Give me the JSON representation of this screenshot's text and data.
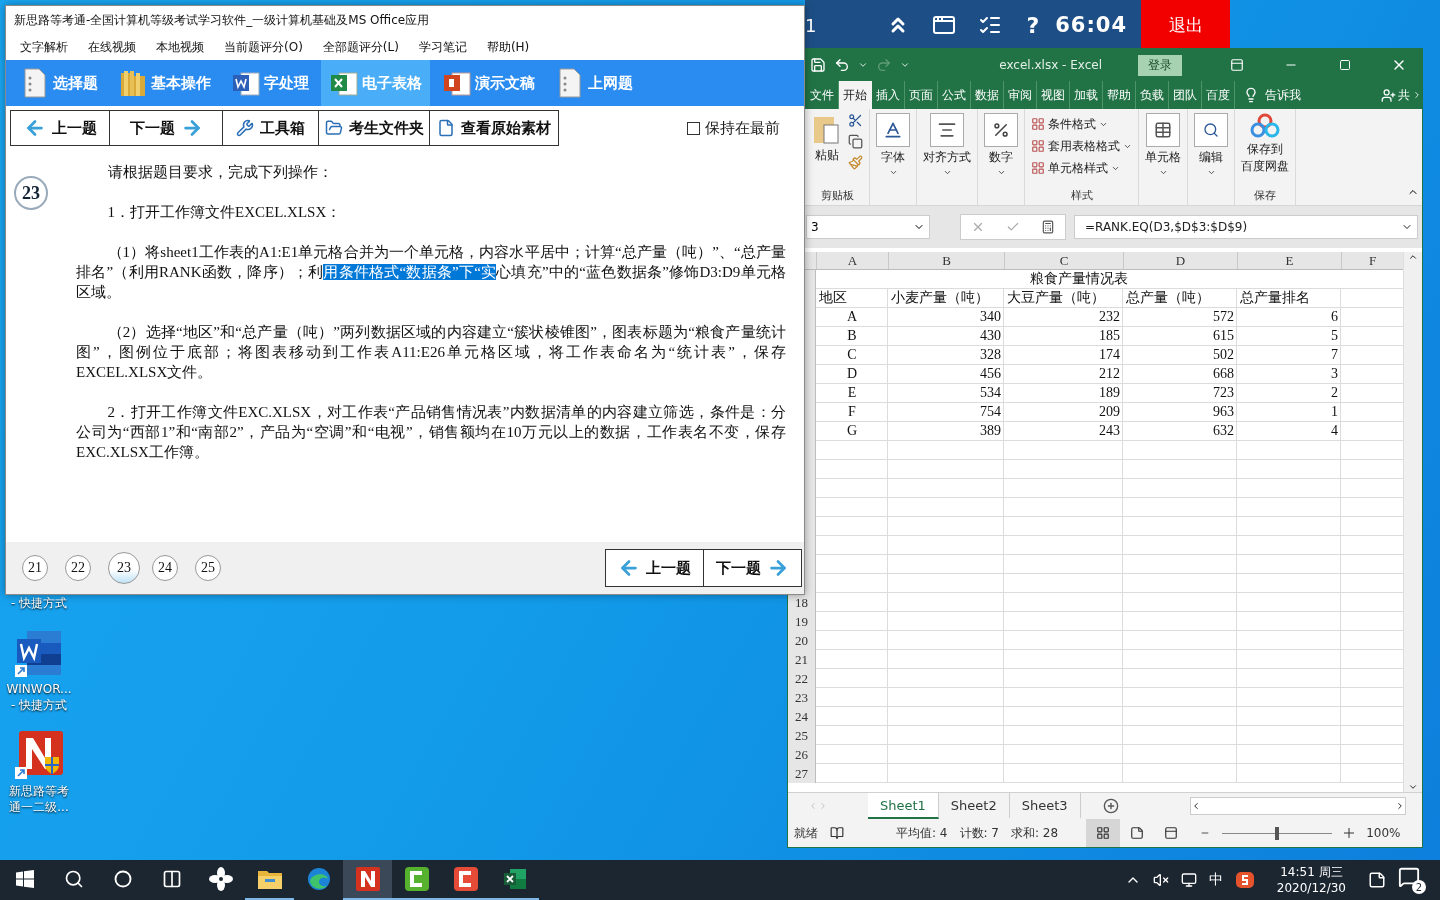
{
  "exam_bar": {
    "cut_text": "1",
    "help_glyph": "?",
    "timer": "66:04",
    "exit_button": "退出"
  },
  "exam_window": {
    "title": "新思路等考通-全国计算机等级考试学习软件_一级计算机基础及MS Office应用",
    "menu": [
      "文字解析",
      "在线视频",
      "本地视频",
      "当前题评分(O)",
      "全部题评分(L)",
      "学习笔记",
      "帮助(H)"
    ],
    "modules": [
      {
        "label": "选择题",
        "kind": "doc",
        "selected": false
      },
      {
        "label": "基本操作",
        "kind": "folder",
        "selected": false
      },
      {
        "label": "字处理",
        "kind": "word",
        "selected": false
      },
      {
        "label": "电子表格",
        "kind": "excel",
        "selected": true
      },
      {
        "label": "演示文稿",
        "kind": "ppt",
        "selected": false
      },
      {
        "label": "上网题",
        "kind": "doc",
        "selected": false
      }
    ],
    "toolbar": [
      {
        "label": "上一题",
        "kind": "prev"
      },
      {
        "label": "下一题",
        "kind": "next"
      },
      {
        "label": "工具箱",
        "kind": "tools"
      },
      {
        "label": "考生文件夹",
        "kind": "folder"
      },
      {
        "label": "查看原始素材",
        "kind": "source"
      }
    ],
    "keep_on_top": {
      "label": "保持在最前",
      "checked": false
    },
    "question_number": "23",
    "paragraphs": [
      {
        "segments": [
          {
            "text": "请根据题目要求，完成下列操作：",
            "selected": false
          }
        ]
      },
      {
        "segments": [
          {
            "text": "1．打开工作簿文件EXCEL.XLSX：",
            "selected": false
          }
        ]
      },
      {
        "segments": [
          {
            "text": "（1）将sheet1工作表的A1:E1单元格合并为一个单元格，内容水平居中；计算“总产量（吨）”、“总产量排名”（利用RANK函数，降序）；利",
            "selected": false
          },
          {
            "text": "用条件格式“数据条”下“实",
            "selected": true
          },
          {
            "text": "心填充”中的“蓝色数据条”修饰D3:D9单元格区域。",
            "selected": false
          }
        ]
      },
      {
        "segments": [
          {
            "text": "（2）选择“地区”和“总产量（吨）”两列数据区域的内容建立“簇状棱锥图”，图表标题为“粮食产量统计图”，图例位于底部；将图表移动到工作表A11:E26单元格区域，将工作表命名为“统计表”，保存EXCEL.XLSX文件。",
            "selected": false
          }
        ]
      },
      {
        "segments": [
          {
            "text": "2．打开工作簿文件EXC.XLSX，对工作表“产品销售情况表”内数据清单的内容建立筛选，条件是：分公司为“西部1”和“南部2”，产品为“空调”和“电视”，销售额均在10万元以上的数据，工作表名不变，保存EXC.XLSX工作簿。",
            "selected": false
          }
        ]
      }
    ],
    "pager": [
      {
        "label": "21",
        "selected": false
      },
      {
        "label": "22",
        "selected": false
      },
      {
        "label": "23",
        "selected": true
      },
      {
        "label": "24",
        "selected": false
      },
      {
        "label": "25",
        "selected": false
      }
    ],
    "bottom_nav": [
      {
        "label": "上一题",
        "kind": "prev"
      },
      {
        "label": "下一题",
        "kind": "next"
      }
    ]
  },
  "excel": {
    "title": "excel.xlsx  -  Excel",
    "sign_in": "登录",
    "tabs": [
      {
        "label": "文件",
        "selected": false
      },
      {
        "label": "开始",
        "selected": true
      },
      {
        "label": "插入",
        "selected": false
      },
      {
        "label": "页面",
        "selected": false
      },
      {
        "label": "公式",
        "selected": false
      },
      {
        "label": "数据",
        "selected": false
      },
      {
        "label": "审阅",
        "selected": false
      },
      {
        "label": "视图",
        "selected": false
      },
      {
        "label": "加载",
        "selected": false
      },
      {
        "label": "帮助",
        "selected": false
      },
      {
        "label": "负载",
        "selected": false
      },
      {
        "label": "团队",
        "selected": false
      },
      {
        "label": "百度",
        "selected": false
      }
    ],
    "tell_me": "告诉我",
    "share": "共",
    "ribbon": {
      "paste": "粘贴",
      "clipboard_group": "剪贴板",
      "big_buttons": [
        {
          "label": "字体",
          "kind": "font"
        },
        {
          "label": "对齐方式",
          "kind": "align"
        },
        {
          "label": "数字",
          "kind": "number"
        }
      ],
      "styles": [
        "条件格式",
        "套用表格格式",
        "单元格样式"
      ],
      "styles_group": "样式",
      "cells": "单元格",
      "editing": "编辑",
      "save_lines": [
        "保存到",
        "百度网盘"
      ],
      "save_group": "保存"
    },
    "name_box": "3",
    "formula": "=RANK.EQ(D3,$D$3:$D$9)",
    "columns": [
      "A",
      "B",
      "C",
      "D",
      "E",
      "F"
    ],
    "title_cell": "粮食产量情况表",
    "headers": [
      "地区",
      "小麦产量（吨）",
      "大豆产量（吨）",
      "总产量（吨）",
      "总产量排名"
    ],
    "rows": [
      [
        "A",
        "340",
        "232",
        "572",
        "6"
      ],
      [
        "B",
        "430",
        "185",
        "615",
        "5"
      ],
      [
        "C",
        "328",
        "174",
        "502",
        "7"
      ],
      [
        "D",
        "456",
        "212",
        "668",
        "3"
      ],
      [
        "E",
        "534",
        "189",
        "723",
        "2"
      ],
      [
        "F",
        "754",
        "209",
        "963",
        "1"
      ],
      [
        "G",
        "389",
        "243",
        "632",
        "4"
      ]
    ],
    "row_numbers": [
      "18",
      "19",
      "20",
      "21",
      "22",
      "23",
      "24",
      "25",
      "26",
      "27"
    ],
    "sheets": [
      {
        "label": "Sheet1",
        "selected": true
      },
      {
        "label": "Sheet2",
        "selected": false
      },
      {
        "label": "Sheet3",
        "selected": false
      }
    ],
    "status": {
      "ready": "就绪",
      "average": "平均值: 4",
      "count": "计数: 7",
      "sum": "求和: 28",
      "zoom": "100%",
      "level": 0.5
    }
  },
  "desktop_icons": [
    {
      "kind": "label",
      "lines": [
        "- 快捷方式"
      ]
    },
    {
      "kind": "word",
      "lines": [
        "WINWOR...",
        "- 快捷方式"
      ]
    },
    {
      "kind": "app",
      "lines": [
        "新思路等考",
        "通一二级..."
      ]
    }
  ],
  "taskbar": {
    "apps": [
      {
        "kind": "start",
        "running": false,
        "selected": false
      },
      {
        "kind": "search",
        "running": false,
        "selected": false
      },
      {
        "kind": "cortana",
        "running": false,
        "selected": false
      },
      {
        "kind": "taskview",
        "running": false,
        "selected": false
      },
      {
        "kind": "pinwheel",
        "running": false,
        "selected": false
      },
      {
        "kind": "explorer",
        "running": true,
        "selected": false
      },
      {
        "kind": "edge",
        "running": false,
        "selected": false
      },
      {
        "kind": "n-app",
        "running": true,
        "selected": true
      },
      {
        "kind": "green-c",
        "running": true,
        "selected": false
      },
      {
        "kind": "red-c",
        "running": true,
        "selected": false
      },
      {
        "kind": "excel",
        "running": true,
        "selected": false
      }
    ],
    "ime": "中",
    "time": "14:51 周三",
    "date": "2020/12/30",
    "notifications": "2"
  }
}
